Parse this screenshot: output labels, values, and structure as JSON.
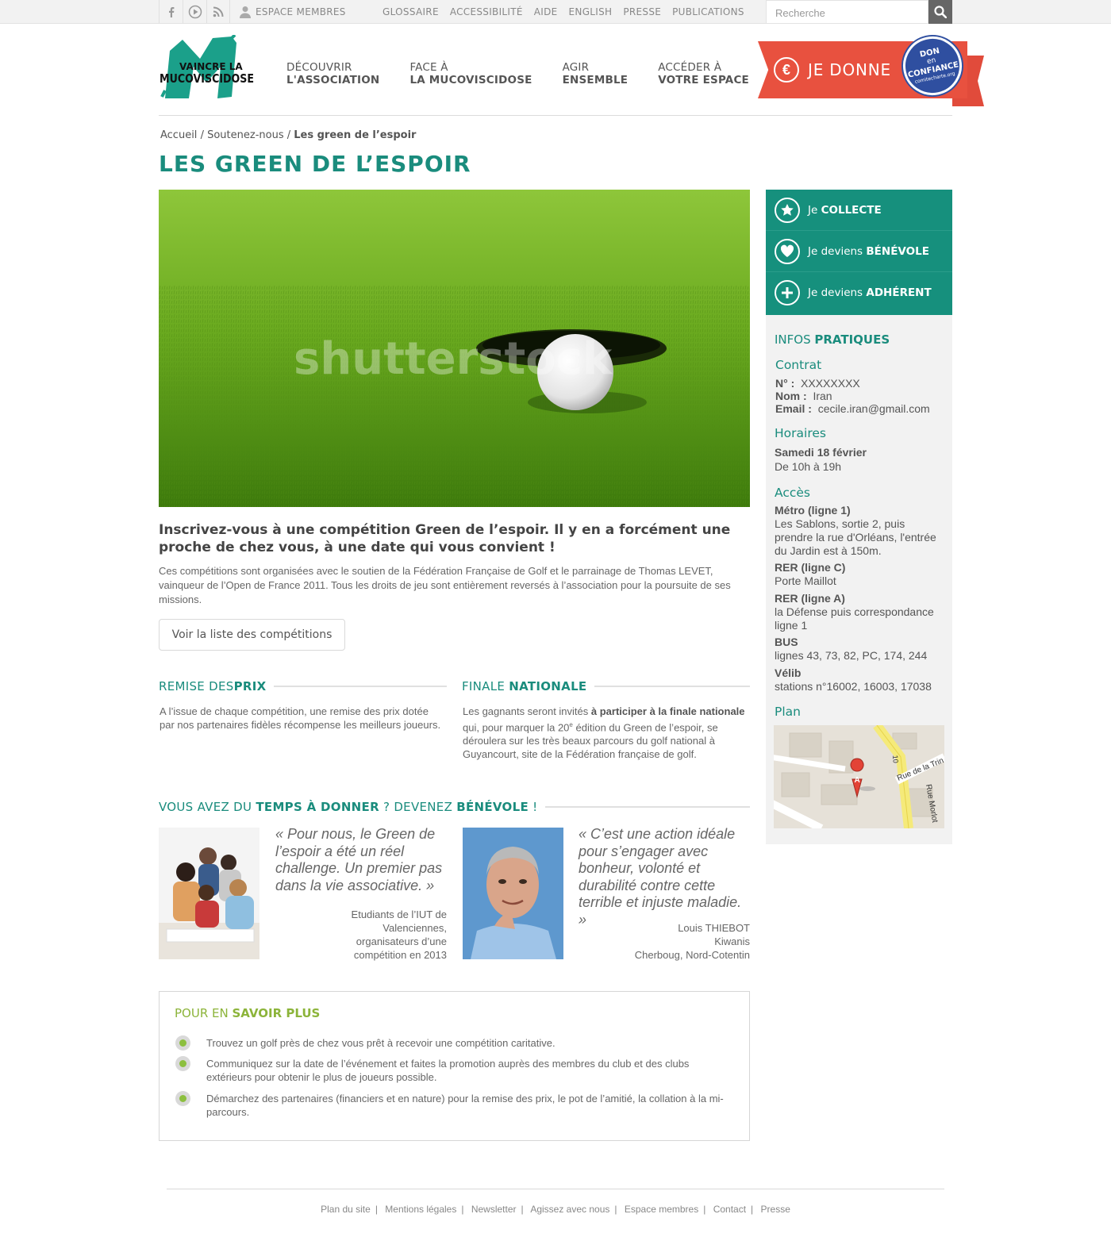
{
  "topbar": {
    "member_link": "ESPACE MEMBRES",
    "links": [
      "GLOSSAIRE",
      "ACCESSIBILITÉ",
      "AIDE",
      "ENGLISH",
      "PRESSE",
      "PUBLICATIONS"
    ],
    "search_placeholder": "Recherche"
  },
  "header": {
    "logo_line1": "VAINCRE LA",
    "logo_line2": "MUCOVISCIDOSE",
    "nav": [
      {
        "line1": "DÉCOUVRIR",
        "line2": "L'ASSOCIATION"
      },
      {
        "line1": "FACE À",
        "line2": "LA MUCOVISCIDOSE"
      },
      {
        "line1": "AGIR",
        "line2": "ENSEMBLE"
      },
      {
        "line1": "ACCÉDER À",
        "line2": "VOTRE ESPACE"
      }
    ],
    "donate_label": "JE DONNE",
    "donate_icon": "€",
    "badge_line1": "DON",
    "badge_line2": "en",
    "badge_line3": "CONFIANCE",
    "badge_line4": "comitecharte.org"
  },
  "breadcrumb": {
    "home": "Accueil",
    "sep": "/",
    "parent": "Soutenez-nous",
    "current": "Les green de l’espoir"
  },
  "page": {
    "title": "LES GREEN DE L’ESPOIR",
    "hero_watermark": "shutterstock",
    "intro_heading": "Inscrivez-vous à une compétition Green de l’espoir. Il y en a forcément une proche de chez vous, à une date qui vous convient !",
    "intro_text": "Ces compétitions sont organisées avec le soutien de la Fédération Française de Golf et le parrainage de Thomas LEVET, vainqueur de l’Open de France 2011. Tous les droits de jeu sont entièrement reversés à l’association pour la poursuite de ses missions.",
    "competitions_button": "Voir la liste des compétitions"
  },
  "remise": {
    "title_plain": "REMISE DES ",
    "title_bold": "PRIX",
    "text": "A l’issue de chaque compétition, une remise des prix dotée par nos partenaires fidèles récompense les meilleurs joueurs."
  },
  "finale": {
    "title_plain": "FINALE ",
    "title_bold": "NATIONALE",
    "text_a": "Les gagnants seront invités ",
    "text_bold": "à participer à la finale nationale",
    "text_b": " qui, pour marquer la 20",
    "text_sup": "e",
    "text_c": " édition du Green de l’espoir, se déroulera sur les très beaux parcours du golf national à Guyancourt, site de la Fédération française de golf."
  },
  "benevole": {
    "p1": "VOUS AVEZ DU ",
    "b1": "TEMPS À DONNER",
    "p2": " ? DEVENEZ ",
    "b2": "BÉNÉVOLE",
    "p3": " !"
  },
  "testimonials": [
    {
      "quote": "« Pour nous, le Green de l’espoir a été un réel challenge. Un premier pas dans la vie associative. »",
      "author_lines": [
        "Etudiants de l’IUT de",
        "Valenciennes,",
        "organisateurs d’une",
        "compétition en 2013"
      ]
    },
    {
      "quote": "« C’est une action idéale pour s’engager avec bonheur, volonté et durabilité contre cette terrible et injuste maladie. »",
      "author_lines": [
        "Louis THIEBOT",
        "Kiwanis",
        "Cherboug, Nord-Cotentin"
      ]
    }
  ],
  "savoir": {
    "title_plain": "POUR EN ",
    "title_bold": "SAVOIR PLUS",
    "items": [
      "Trouvez un golf près de chez vous prêt à recevoir une compétition caritative.",
      "Communiquez sur la date de l’événement et faites la promotion auprès des membres du club et des clubs extérieurs pour obtenir le plus de joueurs possible.",
      "Démarchez des partenaires (financiers et en nature)  pour la remise des prix, le pot de l’amitié, la collation à la mi-parcours."
    ]
  },
  "sidebar": {
    "actions": [
      {
        "plain": "Je ",
        "bold": "COLLECTE"
      },
      {
        "plain": "Je deviens ",
        "bold": "BÉNÉVOLE"
      },
      {
        "plain": "Je deviens ",
        "bold": "ADHÉRENT"
      }
    ],
    "infos_plain": "INFOS ",
    "infos_bold": "PRATIQUES",
    "contrat_title": "Contrat",
    "contrat": [
      {
        "label": "N° :",
        "value": "XXXXXXXX"
      },
      {
        "label": "Nom :",
        "value": "Iran"
      },
      {
        "label": "Email :",
        "value": "cecile.iran@gmail.com"
      }
    ],
    "horaires_title": "Horaires",
    "horaires_date": "Samedi 18 février",
    "horaires_time": "De 10h à 19h",
    "acces_title": "Accès",
    "acces": [
      {
        "label": "Métro (ligne 1)",
        "value": "Les Sablons, sortie 2, puis prendre la rue d'Orléans, l'entrée du Jardin est à 150m."
      },
      {
        "label": "RER (ligne C)",
        "value": "Porte Maillot"
      },
      {
        "label": "RER (ligne A)",
        "value": "la Défense puis correspondance ligne 1"
      },
      {
        "label": "BUS",
        "value": "lignes 43, 73, 82, PC, 174, 244"
      },
      {
        "label": "Vélib",
        "value": "stations n°16002, 16003, 17038"
      }
    ],
    "plan_title": "Plan",
    "map_labels": [
      "Rue de la Trin",
      "Rue Morlot",
      "10",
      "A"
    ]
  },
  "footer": {
    "links": [
      "Plan du site",
      "Mentions légales",
      "Newsletter",
      "Agissez avec nous",
      "Espace membres",
      "Contact",
      "Presse"
    ],
    "separator": "|"
  }
}
